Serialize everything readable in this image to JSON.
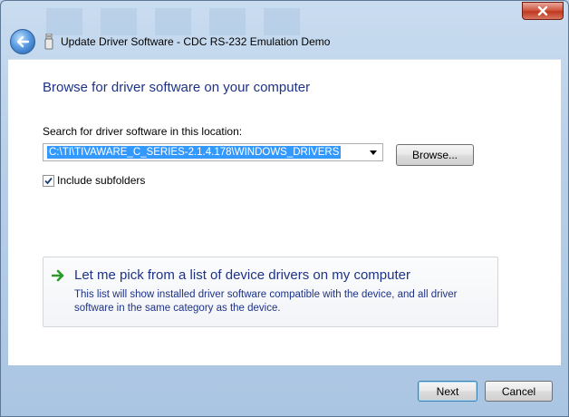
{
  "window": {
    "title": "Update Driver Software - CDC RS-232 Emulation Demo"
  },
  "page": {
    "heading": "Browse for driver software on your computer",
    "search_label": "Search for driver software in this location:",
    "path_value": "C:\\TI\\TIVAWARE_C_SERIES-2.1.4.178\\WINDOWS_DRIVERS",
    "browse_label": "Browse...",
    "include_subfolders_label": "Include subfolders",
    "include_subfolders_checked": true,
    "pick_title": "Let me pick from a list of device drivers on my computer",
    "pick_description": "This list will show installed driver software compatible with the device, and all driver software in the same category as the device."
  },
  "footer": {
    "next_label": "Next",
    "cancel_label": "Cancel"
  },
  "icons": {
    "close": "close-icon",
    "back": "back-arrow-icon",
    "usb": "usb-device-icon",
    "dropdown": "chevron-down-icon",
    "check": "checkmark-icon",
    "pick": "green-arrow-icon"
  },
  "colors": {
    "heading": "#1e3287",
    "selection": "#3399ff",
    "close_button": "#c0391f"
  }
}
